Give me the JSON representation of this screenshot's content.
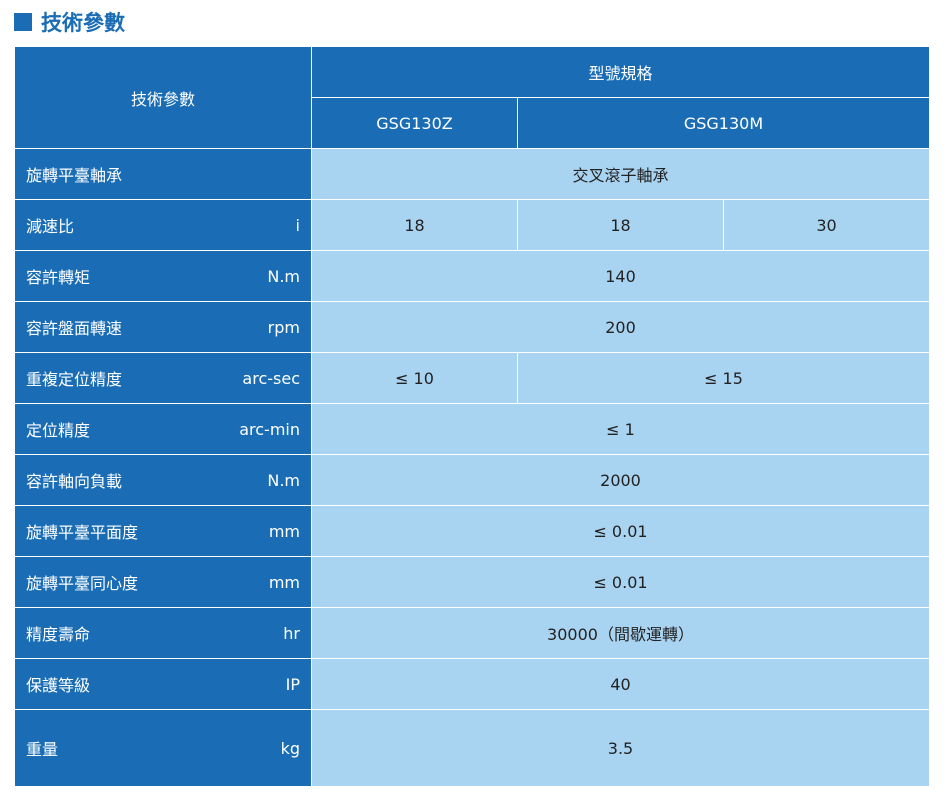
{
  "section": {
    "title": "技術參數"
  },
  "table": {
    "corner_header": "技術參數",
    "model_header": "型號規格",
    "models": [
      "GSG130Z",
      "GSG130M"
    ],
    "rows": [
      {
        "label": "旋轉平臺軸承",
        "unit": "",
        "values": [
          "交叉滾子軸承"
        ]
      },
      {
        "label": "減速比",
        "unit": "i",
        "values": [
          "18",
          "18",
          "30"
        ]
      },
      {
        "label": "容許轉矩",
        "unit": "N.m",
        "values": [
          "140"
        ]
      },
      {
        "label": "容許盤面轉速",
        "unit": "rpm",
        "values": [
          "200"
        ]
      },
      {
        "label": "重複定位精度",
        "unit": "arc-sec",
        "values": [
          "≤ 10",
          "≤ 15"
        ]
      },
      {
        "label": "定位精度",
        "unit": "arc-min",
        "values": [
          "≤ 1"
        ]
      },
      {
        "label": "容許軸向負載",
        "unit": "N.m",
        "values": [
          "2000"
        ]
      },
      {
        "label": "旋轉平臺平面度",
        "unit": "mm",
        "values": [
          "≤ 0.01"
        ]
      },
      {
        "label": "旋轉平臺同心度",
        "unit": "mm",
        "values": [
          "≤ 0.01"
        ]
      },
      {
        "label": "精度壽命",
        "unit": "hr",
        "values": [
          "30000（間歇運轉）"
        ]
      },
      {
        "label": "保護等級",
        "unit": "IP",
        "values": [
          "40"
        ]
      },
      {
        "label": "重量",
        "unit": "kg",
        "values": [
          "3.5"
        ]
      }
    ]
  },
  "colors": {
    "header_blue": "#1a6db5",
    "cell_light_blue": "#a9d4f1"
  }
}
